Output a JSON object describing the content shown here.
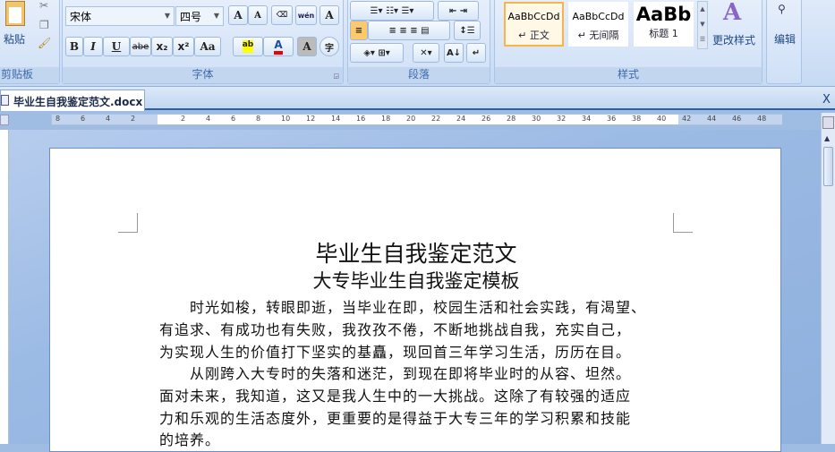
{
  "ribbon": {
    "clipboard": {
      "label": "剪贴板",
      "paste": "粘贴"
    },
    "font": {
      "label": "字体",
      "font_name": "宋体",
      "font_size": "四号",
      "bold": "B",
      "italic": "I",
      "underline": "U",
      "strike": "abe",
      "sub": "x₂",
      "sup": "x²",
      "case": "Aa",
      "grow": "A",
      "shrink": "A",
      "phonetic": "wén",
      "border": "A",
      "shade": "A",
      "circle": "字"
    },
    "paragraph": {
      "label": "段落"
    },
    "styles": {
      "label": "样式",
      "tiles": [
        {
          "preview": "AaBbCcDd",
          "name": "↵ 正文"
        },
        {
          "preview": "AaBbCcDd",
          "name": "↵ 无间隔"
        },
        {
          "preview": "AaBb",
          "name": "标题 1"
        }
      ],
      "change": "更改样式"
    },
    "editing": {
      "label": "编辑"
    }
  },
  "document_tab": {
    "title": "毕业生自我鉴定范文.docx",
    "close": "X"
  },
  "ruler": {
    "ticks": [
      "8",
      "6",
      "4",
      "2",
      "",
      "2",
      "4",
      "6",
      "8",
      "10",
      "12",
      "14",
      "16",
      "18",
      "20",
      "22",
      "24",
      "26",
      "28",
      "30",
      "32",
      "34",
      "36",
      "38",
      "40",
      "42",
      "44",
      "46",
      "48"
    ]
  },
  "document": {
    "title": "毕业生自我鉴定范文",
    "subtitle": "大专毕业生自我鉴定模板",
    "lines": [
      "　　时光如梭，转眼即逝，当毕业在即，校园生活和社会实践，有渴望、",
      "有追求、有成功也有失败，我孜孜不倦，不断地挑战自我，充实自己，",
      "为实现人生的价值打下坚实的基矗，现回首三年学习生活，历历在目。",
      "　　从刚跨入大专时的失落和迷茫，到现在即将毕业时的从容、坦然。",
      "面对未来，我知道，这又是我人生中的一大挑战。这除了有较强的适应",
      "力和乐观的生活态度外，更重要的是得益于大专三年的学习积累和技能",
      "的培养。"
    ]
  }
}
